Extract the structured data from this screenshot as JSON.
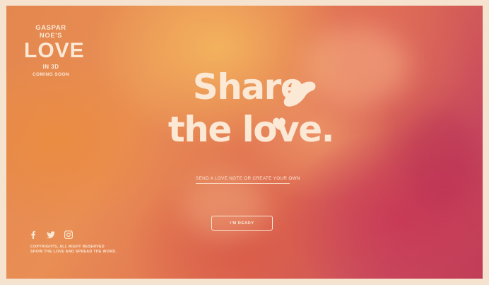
{
  "brand": {
    "top": "GASPAR NOE'S",
    "title": "LOVE",
    "format": "IN 3D",
    "status": "COMING SOON"
  },
  "headline": {
    "line1": "Share",
    "line2": "the love."
  },
  "cta_link": "SEND A LOVE NOTE OR CREATE YOUR OWN",
  "button": "I'M READY",
  "social": [
    "facebook-icon",
    "twitter-icon",
    "instagram-icon"
  ],
  "footer": {
    "line1": "COPYRIGHTS, ALL RIGHT RESERVED",
    "line2": "SHOW THE LOVE AND SPREAD THE WORD."
  },
  "colors": {
    "text": "#fbe8d5",
    "background_orange": "#e98e54",
    "background_magenta": "#c03e58",
    "border": "#f6e3cf"
  }
}
